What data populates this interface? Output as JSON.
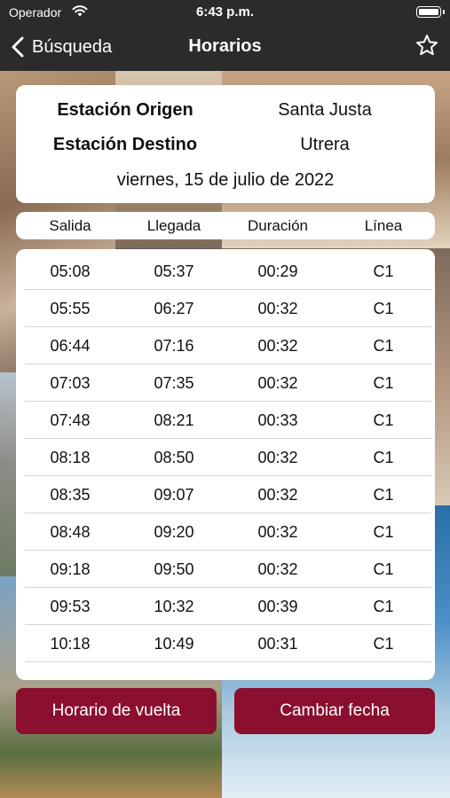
{
  "status_bar": {
    "carrier": "Operador",
    "time": "6:43 p.m."
  },
  "nav": {
    "back_label": "Búsqueda",
    "title": "Horarios"
  },
  "info": {
    "origin_label": "Estación Origen",
    "origin_value": "Santa Justa",
    "destination_label": "Estación Destino",
    "destination_value": "Utrera",
    "date": "viernes, 15 de julio de 2022"
  },
  "table": {
    "headers": [
      "Salida",
      "Llegada",
      "Duración",
      "Línea"
    ],
    "rows": [
      [
        "05:08",
        "05:37",
        "00:29",
        "C1"
      ],
      [
        "05:55",
        "06:27",
        "00:32",
        "C1"
      ],
      [
        "06:44",
        "07:16",
        "00:32",
        "C1"
      ],
      [
        "07:03",
        "07:35",
        "00:32",
        "C1"
      ],
      [
        "07:48",
        "08:21",
        "00:33",
        "C1"
      ],
      [
        "08:18",
        "08:50",
        "00:32",
        "C1"
      ],
      [
        "08:35",
        "09:07",
        "00:32",
        "C1"
      ],
      [
        "08:48",
        "09:20",
        "00:32",
        "C1"
      ],
      [
        "09:18",
        "09:50",
        "00:32",
        "C1"
      ],
      [
        "09:53",
        "10:32",
        "00:39",
        "C1"
      ],
      [
        "10:18",
        "10:49",
        "00:31",
        "C1"
      ]
    ]
  },
  "buttons": {
    "return_label": "Horario de vuelta",
    "change_date_label": "Cambiar fecha"
  },
  "colors": {
    "accent": "#8b0f2e",
    "nav_bg": "#2b2b2b"
  }
}
